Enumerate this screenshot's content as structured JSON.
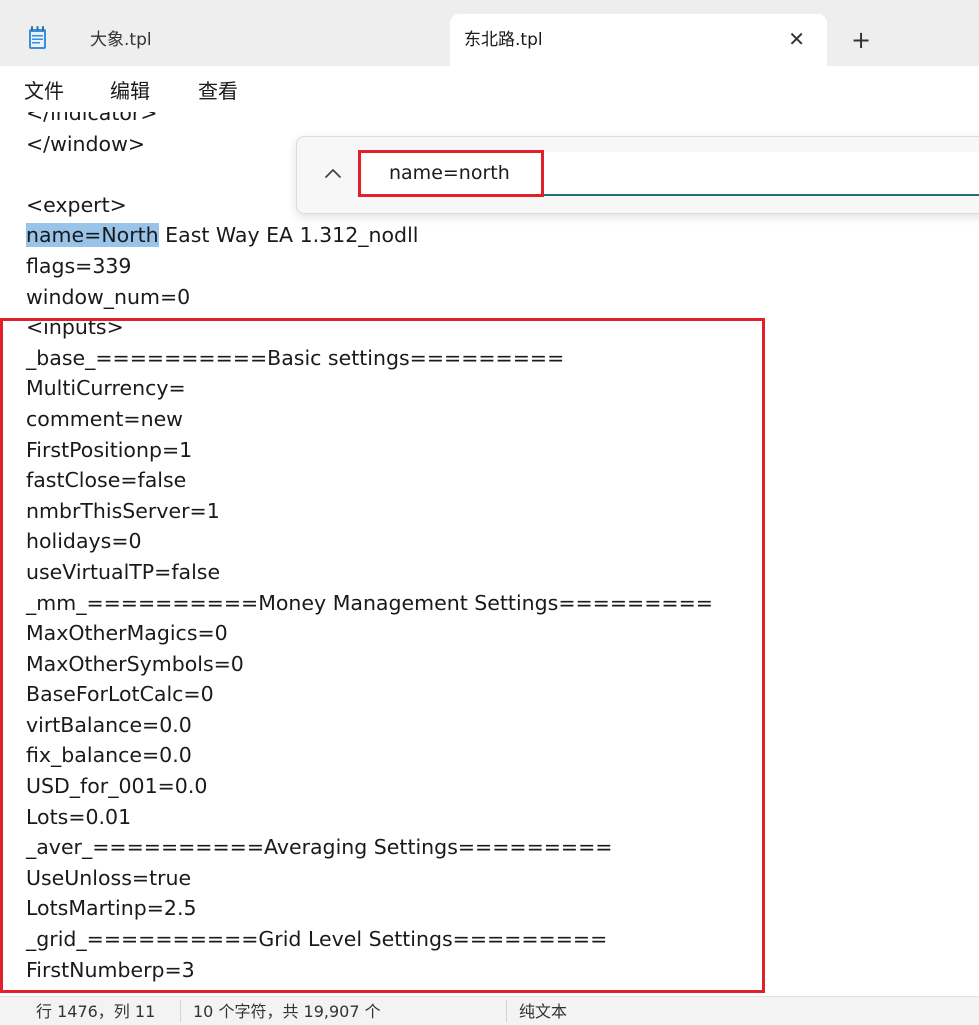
{
  "tabs": [
    {
      "title": "大象.tpl",
      "active": false
    },
    {
      "title": "东北路.tpl",
      "active": true
    }
  ],
  "icons": {
    "app": "notepad-icon",
    "close": "close-icon",
    "new_tab": "plus-icon",
    "chevron": "chevron-up-icon"
  },
  "tab_close_glyph": "✕",
  "new_tab_glyph": "+",
  "menu": [
    "文件",
    "编辑",
    "查看"
  ],
  "editor": {
    "lines": [
      "</indicator>",
      "</window>",
      "",
      "<expert>",
      "",
      "flags=339",
      "window_num=0",
      "<inputs>",
      "_base_==========Basic settings=========",
      "MultiCurrency=",
      "comment=new",
      "FirstPositionp=1",
      "fastClose=false",
      "nmbrThisServer=1",
      "holidays=0",
      "useVirtualTP=false",
      "_mm_==========Money Management Settings=========",
      "MaxOtherMagics=0",
      "MaxOtherSymbols=0",
      "BaseForLotCalc=0",
      "virtBalance=0.0",
      "fix_balance=0.0",
      "USD_for_001=0.0",
      "Lots=0.01",
      "_aver_==========Averaging Settings=========",
      "UseUnloss=true",
      "LotsMartinp=2.5",
      "_grid_==========Grid Level Settings=========",
      "FirstNumberp=3"
    ],
    "match_line": {
      "highlight": "name=North",
      "rest": " East Way EA 1.312_nodll"
    }
  },
  "find": {
    "value": "name=north"
  },
  "status": {
    "position": "行 1476，列 11",
    "selection": "10 个字符，共 19,907 个",
    "encoding": "纯文本"
  },
  "colors": {
    "accent": "#1f6f7a",
    "highlight": "#99c4ea",
    "annotation": "#e0202a"
  }
}
